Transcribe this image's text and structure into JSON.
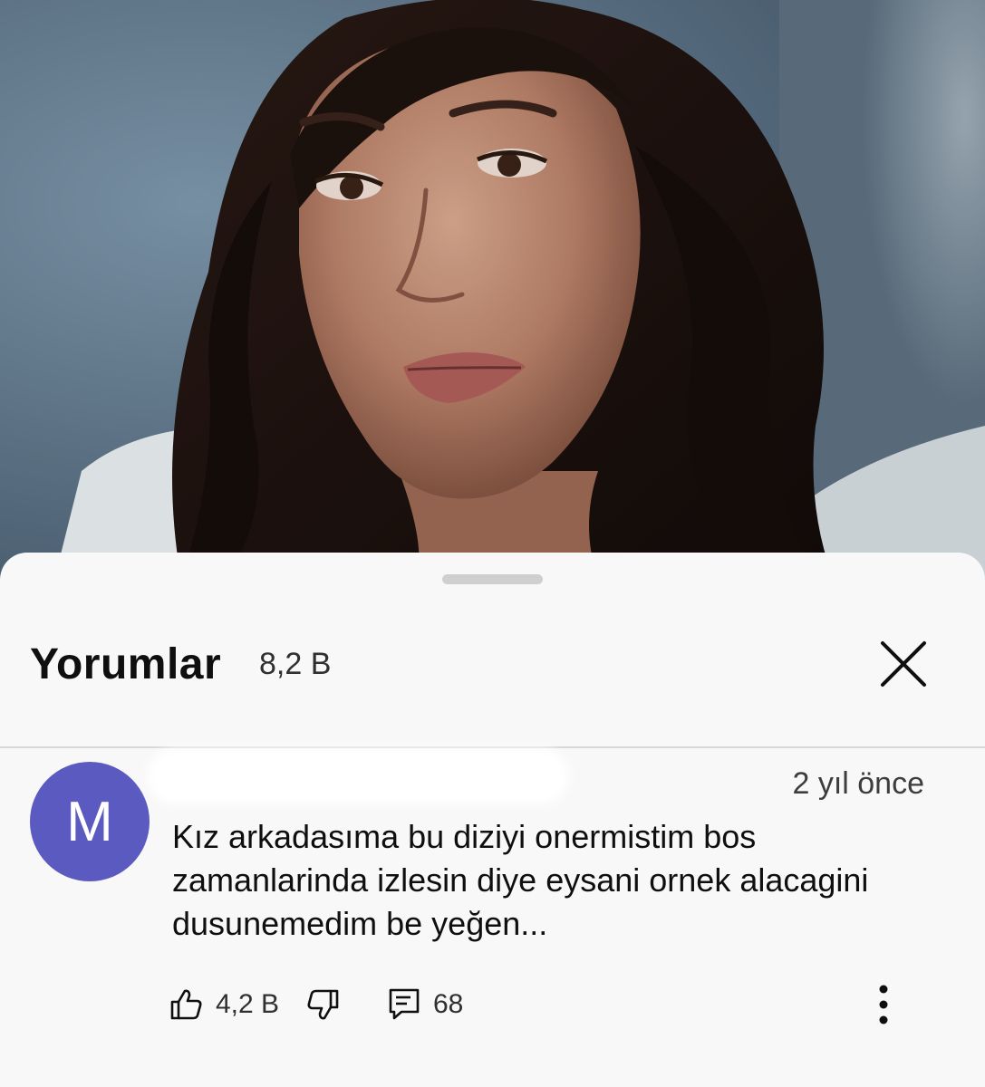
{
  "video": {
    "description_icon": "video-frame"
  },
  "comments_sheet": {
    "title": "Yorumlar",
    "count": "8,2 B",
    "close_icon": "close-icon"
  },
  "comment": {
    "avatar_letter": "M",
    "avatar_color": "#5a5ac0",
    "timestamp": "2 yıl önce",
    "text": "Kız arkadasıma bu diziyi onermistim bos zamanlarinda izlesin diye eysani ornek alacagini dusunemedim be yeğen...",
    "likes": "4,2 B",
    "replies": "68"
  }
}
